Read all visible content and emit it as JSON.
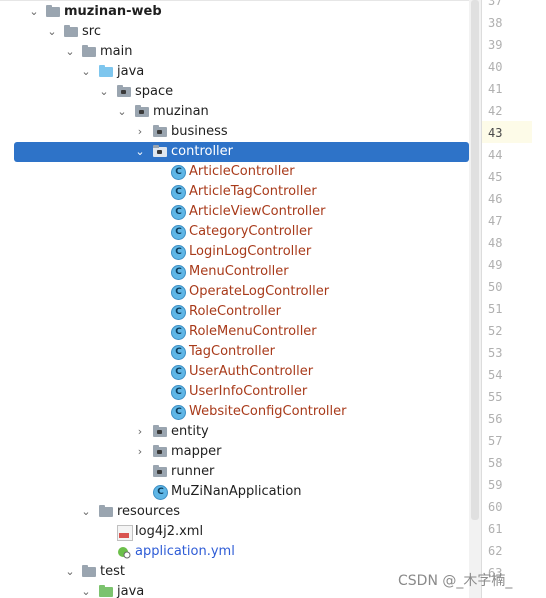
{
  "tree": {
    "project": "muzinan-web",
    "src": "src",
    "main": "main",
    "java": "java",
    "space": "space",
    "muzinan": "muzinan",
    "business": "business",
    "controller": "controller",
    "controllers": [
      "ArticleController",
      "ArticleTagController",
      "ArticleViewController",
      "CategoryController",
      "LoginLogController",
      "MenuController",
      "OperateLogController",
      "RoleController",
      "RoleMenuController",
      "TagController",
      "UserAuthController",
      "UserInfoController",
      "WebsiteConfigController"
    ],
    "entity": "entity",
    "mapper": "mapper",
    "runner": "runner",
    "app_class": "MuZiNanApplication",
    "resources": "resources",
    "log4j2": "log4j2.xml",
    "app_yml": "application.yml",
    "test": "test",
    "test_java": "java"
  },
  "gutter": {
    "line_numbers": [
      "37",
      "38",
      "39",
      "40",
      "41",
      "42",
      "43",
      "44",
      "45",
      "46",
      "47",
      "48",
      "49",
      "50",
      "51",
      "52",
      "53",
      "54",
      "55",
      "56",
      "57",
      "58",
      "59",
      "60",
      "61",
      "62",
      "63"
    ],
    "current_line": "43"
  },
  "watermark": "CSDN @_木字楠_",
  "icons": {
    "class_glyph": "C"
  }
}
